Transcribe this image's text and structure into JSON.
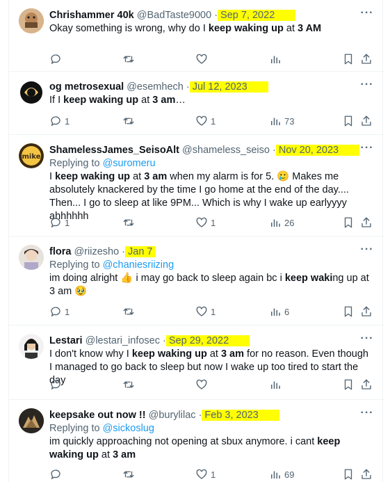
{
  "tweets": [
    {
      "name": "Chrishammer 40k",
      "handle": "@BadTaste9000",
      "date": "Sep 7, 2022",
      "replying": "",
      "replying_to": "",
      "text_html": "Okay something is wrong, why do I <b>keep waking up</b> at <b>3 AM</b>",
      "replies": "",
      "retweets": "",
      "likes": "",
      "views": ""
    },
    {
      "name": "og metrosexual",
      "handle": "@esemhech",
      "date": "Jul 12, 2023",
      "replying": "",
      "replying_to": "",
      "text_html": "If I <b>keep waking up</b> at <b>3 am</b>…",
      "replies": "1",
      "retweets": "",
      "likes": "1",
      "views": "73"
    },
    {
      "name": "ShamelessJames_SeisoAlt",
      "handle": "@shameless_seiso",
      "date": "Nov 20, 2023",
      "replying": "Replying to",
      "replying_to": "@suromeru",
      "text_html": "I <b>keep waking up</b> at <b>3 am</b> when my alarm is for 5. 🥲 Makes me absolutely knackered by the time I go home at the end of the day.... Then... I go to sleep at like 9PM... Which is why I wake up earlyyyy ahhhhhh",
      "replies": "1",
      "retweets": "",
      "likes": "1",
      "views": "26"
    },
    {
      "name": "flora",
      "handle": "@riizesho",
      "date": "Jan 7",
      "replying": "Replying to",
      "replying_to": "@chaniesriizing",
      "text_html": "im doing alright 👍 i may go back to sleep again bc i <b>keep waki</b>ng up at 3 am 🥹",
      "replies": "1",
      "retweets": "",
      "likes": "1",
      "views": "6"
    },
    {
      "name": "Lestari",
      "handle": "@lestari_infosec",
      "date": "Sep 29, 2022",
      "replying": "",
      "replying_to": "",
      "text_html": "I don't know why I <b>keep waking up</b> at <b>3 am</b> for no reason. Even though I managed to go back to sleep but now I wake up too tired to start the day",
      "replies": "",
      "retweets": "",
      "likes": "",
      "views": ""
    },
    {
      "name": "keepsake out now !!",
      "handle": "@burylilac",
      "date": "Feb 3, 2023",
      "replying": "Replying to",
      "replying_to": "@sickoslug",
      "text_html": "im quickly approaching not opening at sbux anymore. i cant <b>keep waking up</b> at <b>3 am</b>",
      "replies": "",
      "retweets": "",
      "likes": "1",
      "views": "69"
    }
  ],
  "colors": {
    "highlight": "#ffff00",
    "link": "#1d9bf0",
    "muted": "#536471",
    "text": "#0f1419"
  },
  "icons": [
    "more-icon",
    "reply-icon",
    "retweet-icon",
    "like-icon",
    "views-icon",
    "bookmark-icon",
    "share-icon"
  ]
}
